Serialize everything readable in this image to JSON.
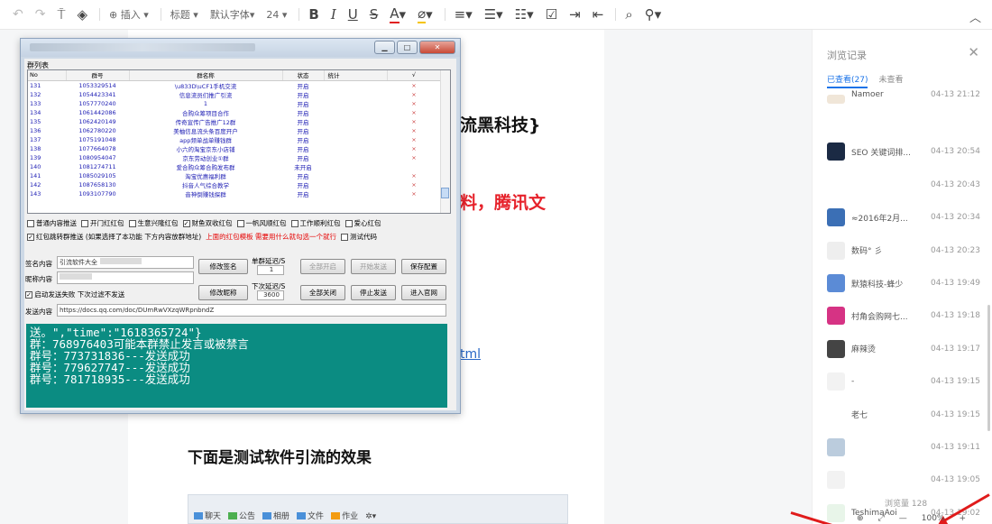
{
  "toolbar": {
    "insert": "插入",
    "heading": "标题",
    "font": "默认字体",
    "size": "24",
    "bold": "B",
    "italic": "I",
    "underline": "U",
    "strike": "S",
    "color": "A"
  },
  "doc": {
    "line1": "流黑科技}",
    "line2a": "料，",
    "line2b": "腾讯文",
    "link": "tml",
    "heading2": "下面是测试软件引流的效果"
  },
  "qq_bar": [
    "聊天",
    "公告",
    "相册",
    "文件",
    "作业"
  ],
  "window": {
    "group_list_label": "群列表",
    "columns": [
      "No",
      "群号",
      "群名称",
      "状态",
      "统计",
      "√"
    ],
    "rows": [
      [
        "131",
        "1053329514",
        "\\u833D\\uCF1手机交流",
        "开启",
        "",
        "×"
      ],
      [
        "132",
        "1054423341",
        "信息流员们推广引流",
        "开启",
        "",
        "×"
      ],
      [
        "133",
        "1057770240",
        "1",
        "开启",
        "",
        "×"
      ],
      [
        "134",
        "1061442086",
        "合购众筹项目合作",
        "开启",
        "",
        "×"
      ],
      [
        "135",
        "1062420149",
        "传奇宣传广告推广12群",
        "开启",
        "",
        "×"
      ],
      [
        "136",
        "1062780220",
        "美柚信息流头条百度开户",
        "开启",
        "",
        "×"
      ],
      [
        "137",
        "1075191048",
        "app频单战单赚钱群",
        "开启",
        "",
        "×"
      ],
      [
        "138",
        "1077664078",
        "小六的淘宝京东小店铺",
        "开启",
        "",
        "×"
      ],
      [
        "139",
        "1080954047",
        "京东劳动创业①群",
        "开启",
        "",
        "×"
      ],
      [
        "140",
        "1081274711",
        "爱合购众筹合购发布群",
        "未开启",
        "",
        ""
      ],
      [
        "141",
        "1085029105",
        "淘宝优惠福利群",
        "开启",
        "",
        "×"
      ],
      [
        "142",
        "1087658130",
        "抖音人气综合教学",
        "开启",
        "",
        "×"
      ],
      [
        "143",
        "1093107790",
        "音神倒赚钱探群",
        "开启",
        "",
        "×"
      ]
    ],
    "checks1": [
      {
        "label": "普通内容推送",
        "on": false
      },
      {
        "label": "开门红红包",
        "on": false
      },
      {
        "label": "生意兴隆红包",
        "on": false
      },
      {
        "label": "财鱼双收红包",
        "on": true
      },
      {
        "label": "一帆风顺红包",
        "on": false
      },
      {
        "label": "工作顺利红包",
        "on": false
      },
      {
        "label": "爱心红包",
        "on": false
      }
    ],
    "check_jump": "红包跳转群推送 (如果选择了本功能 下方内容放群地址)",
    "jump_note": "上面的红包模板 需要用什么就勾选一个就行",
    "test_code": "测试代码",
    "sign_label": "签名内容",
    "sign_value": "引流软件大全",
    "nick_label": "昵称内容",
    "auto_resend": "启动发送失败 下次过滤不发送",
    "btn_modify_sign": "修改签名",
    "btn_modify_nick": "修改昵称",
    "single_delay_label": "单群延迟/S",
    "single_delay": "1",
    "next_delay_label": "下次延迟/S",
    "next_delay": "3600",
    "btn_all_open": "全部开启",
    "btn_start_send": "开始发送",
    "btn_save": "保存配置",
    "btn_all_close": "全部关闭",
    "btn_stop_send": "停止发送",
    "btn_enter_group": "进入官网",
    "send_label": "发送内容",
    "send_value": "https://docs.qq.com/doc/DUmRwVXzqWRpnbndZ",
    "log": [
      "送。\",\"time\":\"1618365724\"}",
      "群：768976403可能本群禁止发言或被禁言",
      "群号：773731836---发送成功",
      "群号：779627747---发送成功",
      "群号：781718935---发送成功"
    ]
  },
  "sidebar": {
    "title": "浏览记录",
    "tab_viewed": "已查看(27)",
    "tab_unviewed": "未查看",
    "items": [
      {
        "name": "Namoer",
        "time": "04-13 21:12"
      },
      {
        "name": "SEO 关键词排...",
        "time": "04-13 20:54"
      },
      {
        "name": "",
        "time": "04-13 20:43"
      },
      {
        "name": "≈2016年2月...",
        "time": "04-13 20:34"
      },
      {
        "name": "数码° 彡",
        "time": "04-13 20:23"
      },
      {
        "name": "默猿科技-蜂少",
        "time": "04-13 19:49"
      },
      {
        "name": "村角会购网七...",
        "time": "04-13 19:18"
      },
      {
        "name": "麻辣烫",
        "time": "04-13 19:17"
      },
      {
        "name": "-",
        "time": "04-13 19:15"
      },
      {
        "name": "老七",
        "time": "04-13 19:15"
      },
      {
        "name": "",
        "time": "04-13 19:11"
      },
      {
        "name": "",
        "time": "04-13 19:05"
      },
      {
        "name": "TeshimaAoi",
        "time": "04-13 19:02"
      }
    ],
    "views": "浏览量 128"
  },
  "status": {
    "zoom": "100%"
  }
}
